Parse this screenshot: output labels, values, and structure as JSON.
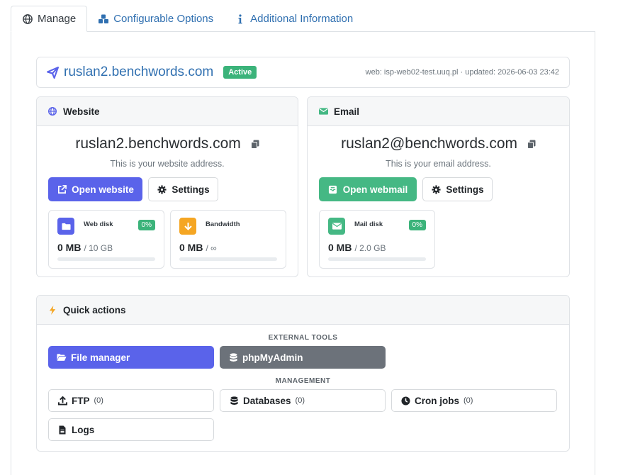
{
  "tabs": [
    {
      "label": "Manage",
      "icon": "globe-icon",
      "active": true
    },
    {
      "label": "Configurable Options",
      "icon": "cubes-icon",
      "active": false
    },
    {
      "label": "Additional Information",
      "icon": "info-icon",
      "active": false
    }
  ],
  "domain": {
    "name": "ruslan2.benchwords.com",
    "status": "Active",
    "meta": "web: isp-web02-test.uuq.pl · updated: 2026-06-03 23:42"
  },
  "website": {
    "header": "Website",
    "address": "ruslan2.benchwords.com",
    "subtitle": "This is your website address.",
    "open_label": "Open website",
    "settings_label": "Settings",
    "stats": [
      {
        "label": "Web disk",
        "percent_text": "0%",
        "percent": 0,
        "value": "0 MB",
        "max": "/ 10 GB",
        "icon": "folder-icon",
        "color": "#5a63ea"
      },
      {
        "label": "Bandwidth",
        "percent_text": "",
        "percent": 0,
        "value": "0 MB",
        "max": "/ ∞",
        "icon": "arrow-down-icon",
        "color": "#f5a623"
      }
    ]
  },
  "email": {
    "header": "Email",
    "address": "ruslan2@benchwords.com",
    "subtitle": "This is your email address.",
    "open_label": "Open webmail",
    "settings_label": "Settings",
    "stats": [
      {
        "label": "Mail disk",
        "percent_text": "0%",
        "percent": 0,
        "value": "0 MB",
        "max": "/ 2.0 GB",
        "icon": "envelope-icon",
        "color": "#45b884"
      }
    ]
  },
  "quick_actions": {
    "header": "Quick actions",
    "external_label": "EXTERNAL TOOLS",
    "file_manager_label": "File manager",
    "phpmyadmin_label": "phpMyAdmin",
    "management_label": "MANAGEMENT",
    "ftp": {
      "label": "FTP",
      "count": "(0)"
    },
    "databases": {
      "label": "Databases",
      "count": "(0)"
    },
    "cron": {
      "label": "Cron jobs",
      "count": "(0)"
    },
    "logs": {
      "label": "Logs"
    }
  },
  "colors": {
    "primary": "#5a63ea",
    "success": "#45b884",
    "secondary": "#6c727a",
    "warning": "#f5a623",
    "link": "#2f6fb0"
  }
}
